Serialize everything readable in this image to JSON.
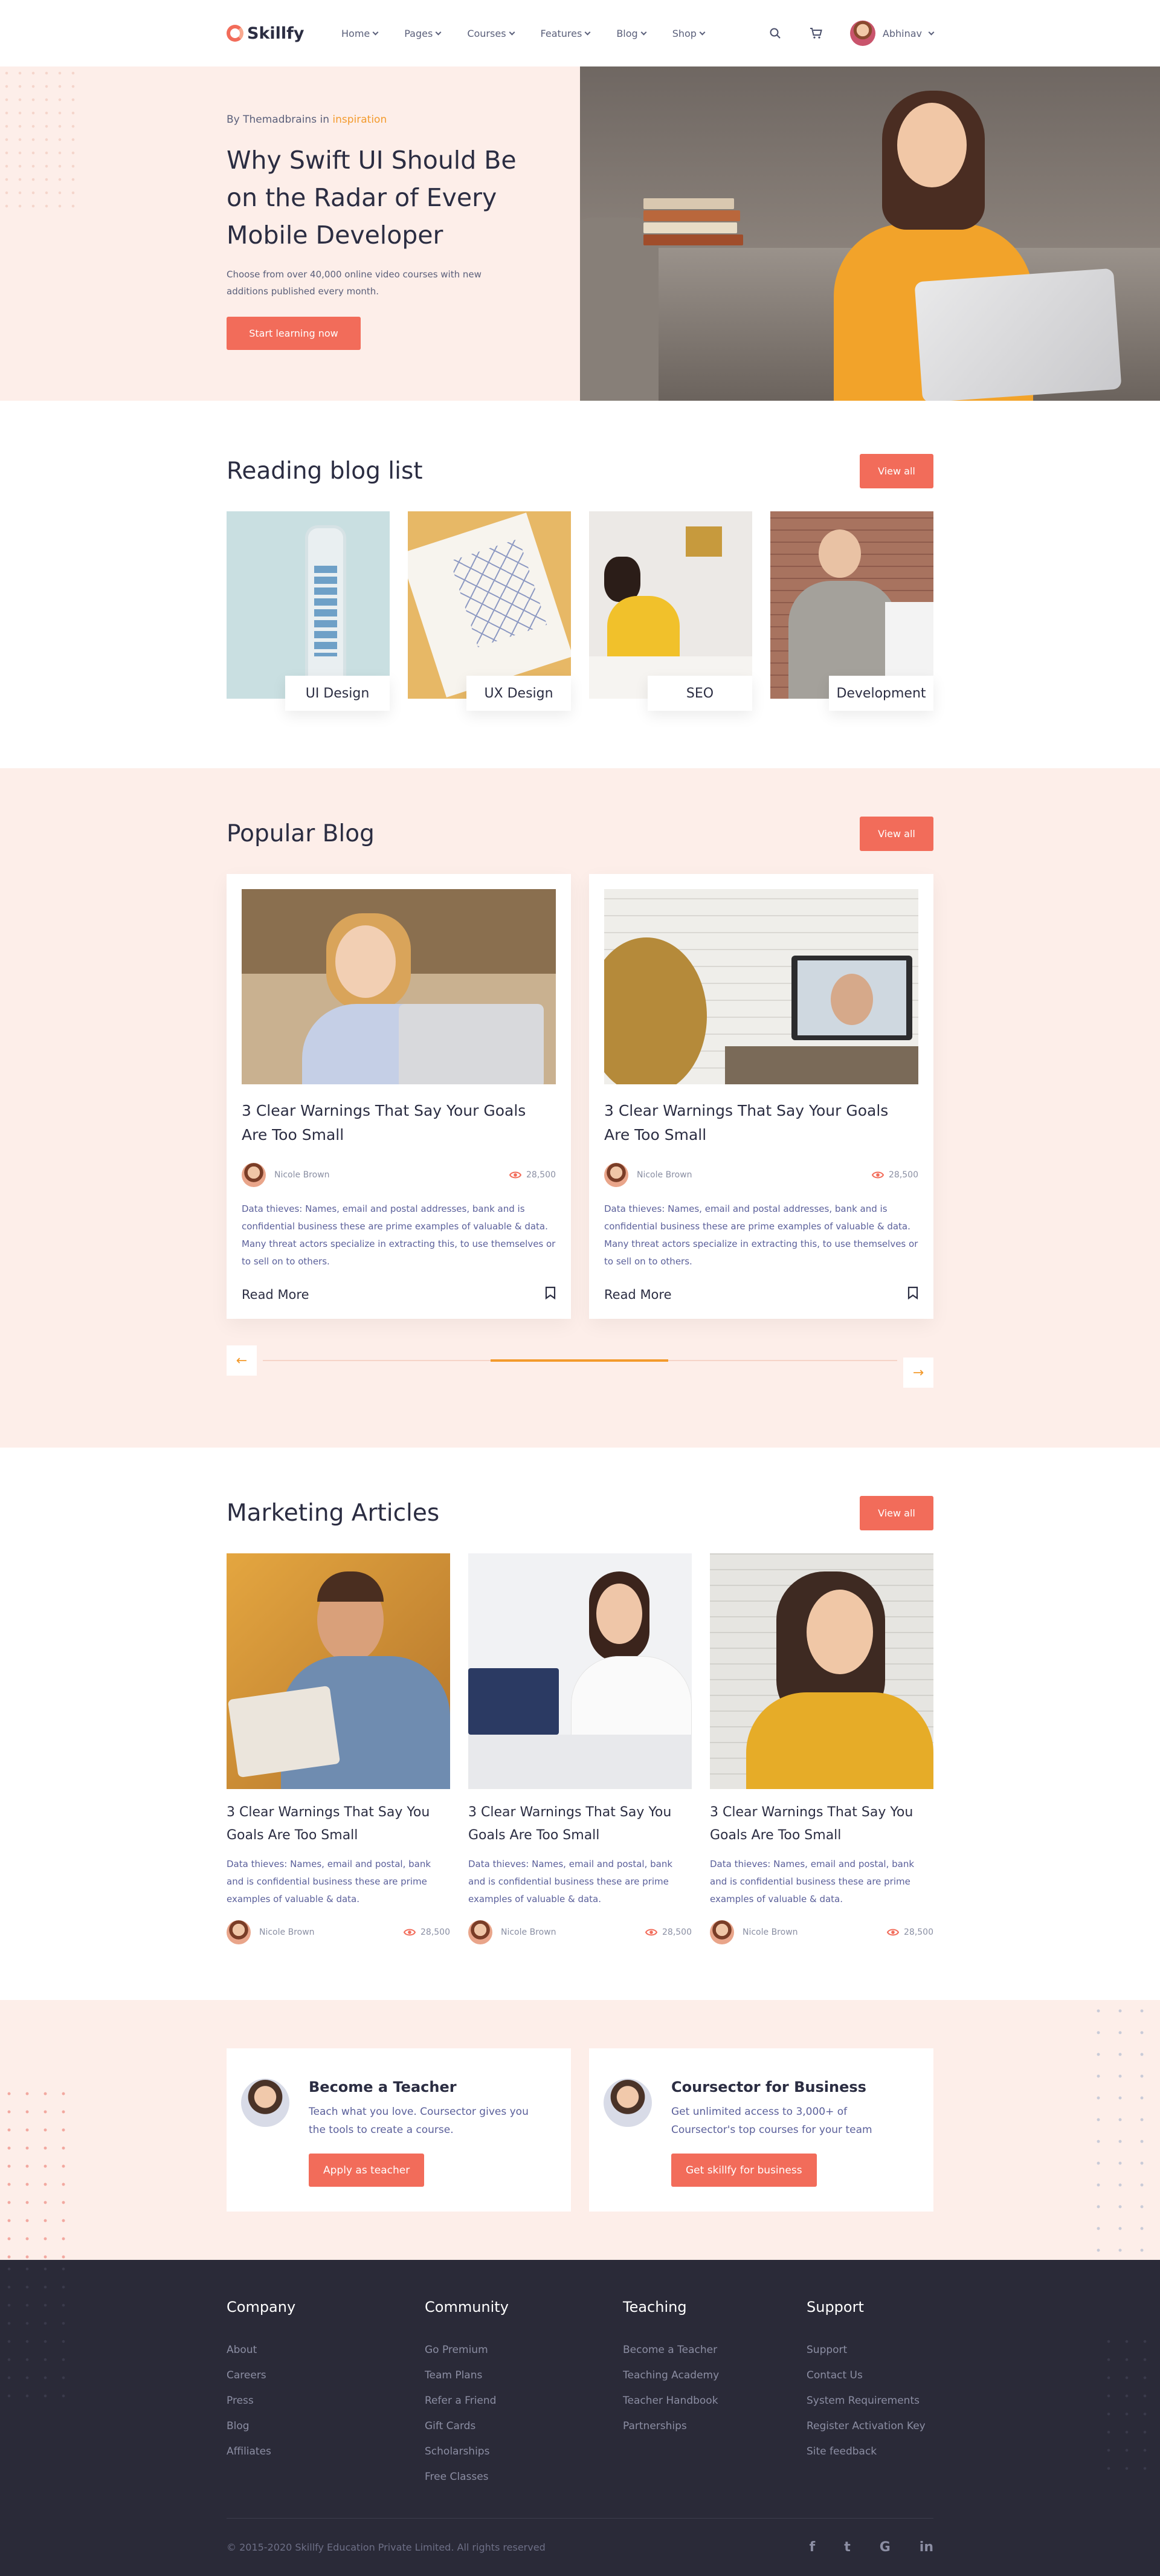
{
  "brand": {
    "name": "Skillfy"
  },
  "nav": {
    "items": [
      "Home",
      "Pages",
      "Courses",
      "Features",
      "Blog",
      "Shop"
    ],
    "user_name": "Abhinav"
  },
  "hero": {
    "by": "By Themadbrains in ",
    "category": "inspiration",
    "title": "Why Swift UI Should Be on the Radar of Every Mobile Developer",
    "subtitle": "Choose from over 40,000 online video courses with new additions published every month.",
    "cta": "Start learning now"
  },
  "reading": {
    "title": "Reading blog list",
    "view_all": "View all",
    "categories": [
      "UI Design",
      "UX Design",
      "SEO",
      "Development"
    ]
  },
  "popular": {
    "title": "Popular Blog",
    "view_all": "View all",
    "posts": [
      {
        "title": "3 Clear Warnings That Say Your Goals Are Too Small",
        "author": "Nicole Brown",
        "views": "28,500",
        "desc": "Data thieves: Names, email and postal addresses, bank and is confidential business these are prime examples of valuable & data. Many threat actors specialize in extracting this, to use themselves or to sell on to others.",
        "read_more": "Read More"
      },
      {
        "title": "3 Clear Warnings That Say Your Goals Are Too Small",
        "author": "Nicole Brown",
        "views": "28,500",
        "desc": "Data thieves: Names, email and postal addresses, bank and is confidential business these are prime examples of valuable & data. Many threat actors specialize in extracting this, to use themselves or to sell on to others.",
        "read_more": "Read More"
      }
    ],
    "slider_progress": 0.28
  },
  "marketing": {
    "title": "Marketing Articles",
    "view_all": "View all",
    "articles": [
      {
        "title": "3 Clear Warnings That Say You Goals Are Too Small",
        "desc": "Data thieves: Names, email and postal, bank and is confidential business these are prime examples of valuable & data.",
        "author": "Nicole Brown",
        "views": "28,500"
      },
      {
        "title": "3 Clear Warnings That Say You Goals Are Too Small",
        "desc": "Data thieves: Names, email and postal, bank and is confidential business these are prime examples of valuable & data.",
        "author": "Nicole Brown",
        "views": "28,500"
      },
      {
        "title": "3 Clear Warnings That Say You Goals Are Too Small",
        "desc": "Data thieves: Names, email and postal, bank and is confidential business these are prime examples of valuable & data.",
        "author": "Nicole Brown",
        "views": "28,500"
      }
    ]
  },
  "cta": {
    "teacher": {
      "title": "Become a Teacher",
      "text": "Teach what you love. Coursector gives you the tools to create a course.",
      "button": "Apply as teacher"
    },
    "business": {
      "title": "Coursector for Business",
      "text": "Get unlimited access to 3,000+ of Coursector's top courses for your team",
      "button": "Get skillfy for business"
    }
  },
  "footer": {
    "columns": [
      {
        "title": "Company",
        "links": [
          "About",
          "Careers",
          "Press",
          "Blog",
          "Affiliates"
        ]
      },
      {
        "title": "Community",
        "links": [
          "Go Premium",
          "Team Plans",
          "Refer a Friend",
          "Gift Cards",
          "Scholarships",
          "Free Classes"
        ]
      },
      {
        "title": "Teaching",
        "links": [
          "Become a Teacher",
          "Teaching Academy",
          "Teacher Handbook",
          "Partnerships"
        ]
      },
      {
        "title": "Support",
        "links": [
          "Support",
          "Contact Us",
          "System Requirements",
          "Register Activation Key",
          "Site feedback"
        ]
      }
    ],
    "copyright": "© 2015-2020 Skillfy Education Private Limited. All rights reserved",
    "social": [
      "f",
      "t",
      "G",
      "in"
    ]
  },
  "colors": {
    "accent": "#f26c5a",
    "orange": "#f39a2c",
    "blush": "#fdeee9",
    "footer": "#2a2a38",
    "text": "#2b2d42"
  },
  "icons": [
    "search-icon",
    "cart-icon",
    "chevron-down-icon",
    "eye-icon",
    "bookmark-icon",
    "arrow-left-icon",
    "arrow-right-icon",
    "facebook-icon",
    "twitter-icon",
    "google-icon",
    "linkedin-icon"
  ]
}
